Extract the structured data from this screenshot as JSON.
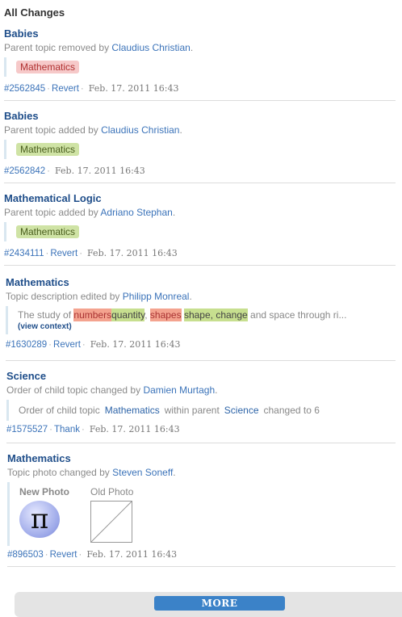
{
  "heading": "All Changes",
  "entries": [
    {
      "title": "Babies",
      "action": "Parent topic removed by",
      "user": "Claudius Christian",
      "tag": "Mathematics",
      "id": "#2562845",
      "revert": "Revert",
      "date": "Feb. 17. 2011 16:43"
    },
    {
      "title": "Babies",
      "action": "Parent topic added by",
      "user": "Claudius Christian",
      "tag": "Mathematics",
      "id": "#2562842",
      "date": "Feb. 17. 2011 16:43"
    },
    {
      "title": "Mathematical Logic",
      "action": "Parent topic added by",
      "user": "Adriano Stephan",
      "tag": "Mathematics",
      "id": "#2434111",
      "revert": "Revert",
      "date": "Feb. 17. 2011 16:43"
    },
    {
      "title": "Mathematics",
      "action": "Topic description edited by",
      "user": "Philipp Monreal",
      "excerpt_start": "The study of",
      "del1": "numbers",
      "ins1": "quantity",
      "mid": ",",
      "del2": "shapes",
      "ins2": "shape, change",
      "excerpt_end": "and space through ri...",
      "context_link": "(view context)",
      "id": "#1630289",
      "revert": "Revert",
      "date": "Feb. 17. 2011 16:43"
    },
    {
      "title": "Science",
      "action": "Order of child topic changed by",
      "user": "Damien Murtagh",
      "order_prefix": "Order of child topic",
      "child_topic": "Mathematics",
      "order_middle": "within parent",
      "parent_topic": "Science",
      "order_suffix": "changed to 6",
      "id": "#1575527",
      "thank": "Thank",
      "date": "Feb. 17. 2011 16:43"
    },
    {
      "title": "Mathematics",
      "action": "Topic photo changed by",
      "user": "Steven Soneff",
      "new_photo_label": "New Photo",
      "old_photo_label": "Old Photo",
      "pi_symbol": "π",
      "id": "#896503",
      "revert": "Revert",
      "date": "Feb. 17. 2011 16:43"
    }
  ],
  "more_label": "MORE",
  "colors": {
    "title_blue": "#1f4e8a",
    "link_blue": "#3b73b9",
    "removed_tag": "#f6c9c9",
    "added_tag": "#cfe3a5",
    "more_button": "#3b82c8"
  }
}
